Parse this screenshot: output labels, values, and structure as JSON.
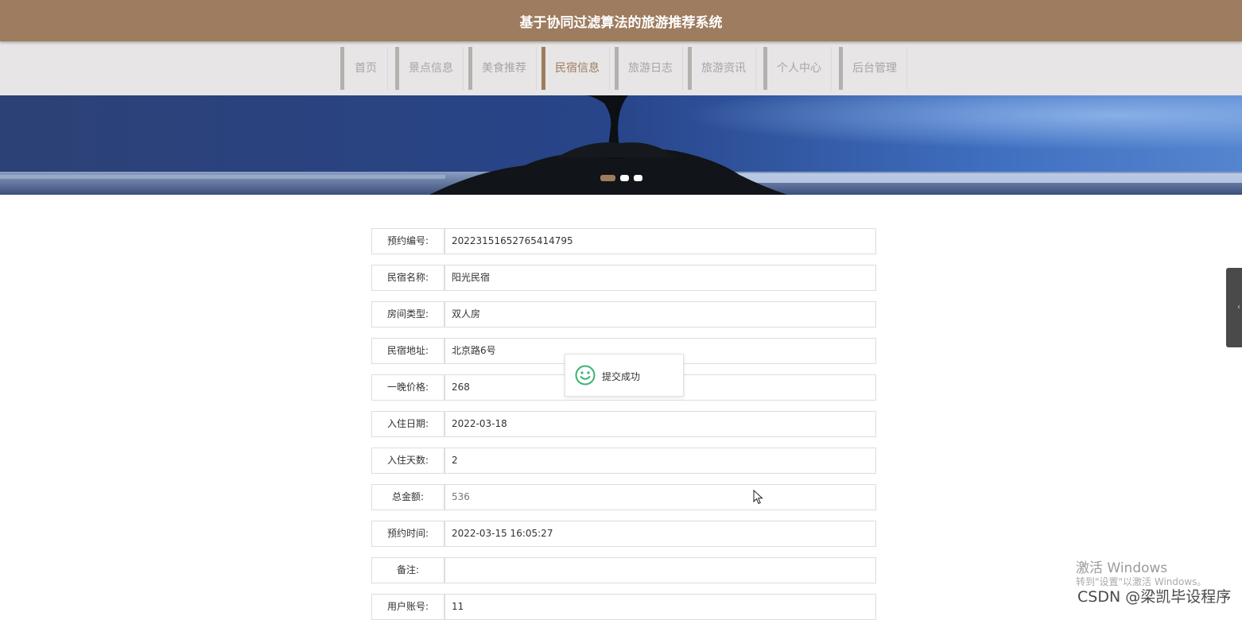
{
  "header": {
    "title": "基于协同过滤算法的旅游推荐系统"
  },
  "nav": {
    "items": [
      {
        "label": "首页"
      },
      {
        "label": "景点信息"
      },
      {
        "label": "美食推荐"
      },
      {
        "label": "民宿信息"
      },
      {
        "label": "旅游日志"
      },
      {
        "label": "旅游资讯"
      },
      {
        "label": "个人中心"
      },
      {
        "label": "后台管理"
      }
    ],
    "active_label": "民宿信息"
  },
  "banner": {
    "slide_count": 3,
    "active_slide": 1
  },
  "form": {
    "rows": [
      {
        "label": "预约编号:",
        "value": "20223151652765414795"
      },
      {
        "label": "民宿名称:",
        "value": "阳光民宿"
      },
      {
        "label": "房间类型:",
        "value": "双人房"
      },
      {
        "label": "民宿地址:",
        "value": "北京路6号"
      },
      {
        "label": "一晚价格:",
        "value": "268"
      },
      {
        "label": "入住日期:",
        "value": "2022-03-18"
      },
      {
        "label": "入住天数:",
        "value": "2"
      },
      {
        "label": "总金额:",
        "value": "536"
      },
      {
        "label": "预约时间:",
        "value": "2022-03-15 16:05:27"
      },
      {
        "label": "备注:",
        "value": ""
      },
      {
        "label": "用户账号:",
        "value": "11"
      }
    ]
  },
  "toast": {
    "message": "提交成功",
    "icon": "smile-icon"
  },
  "overlay": {
    "windows_activate_title": "激活 Windows",
    "windows_activate_hint": "转到\"设置\"以激活 Windows。",
    "csdn_watermark": "CSDN @梁凯毕设程序"
  },
  "colors": {
    "accent": "#9e7c5f",
    "nav_bg": "#e7e5e5",
    "toast_icon": "#3cb371"
  }
}
